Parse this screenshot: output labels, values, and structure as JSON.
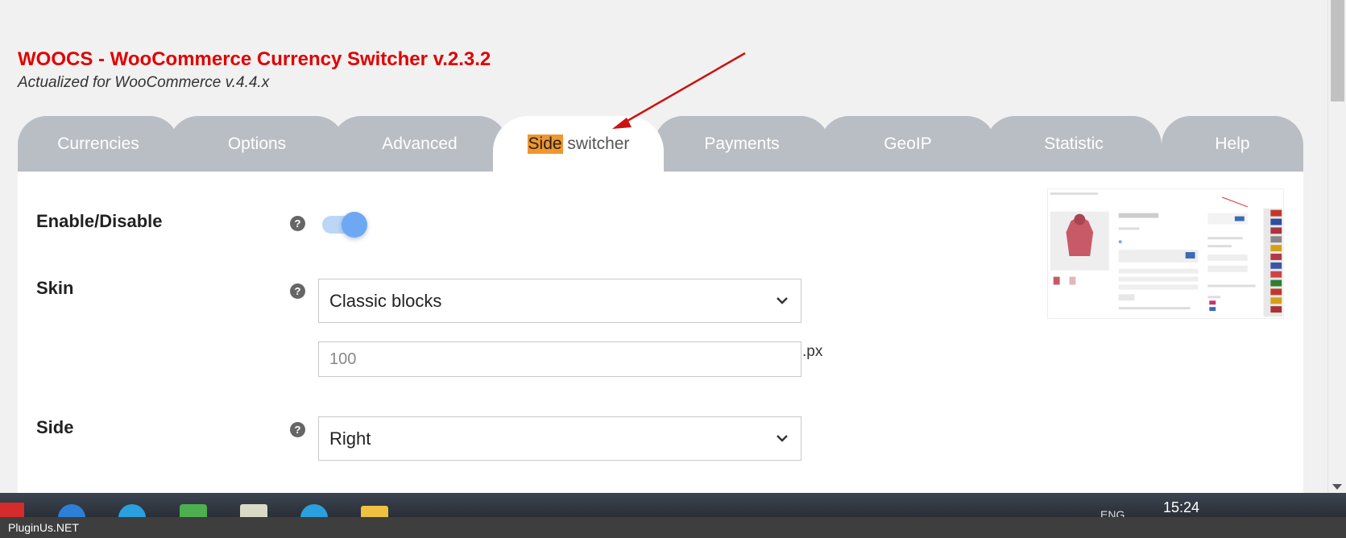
{
  "header": {
    "title": "WOOCS - WooCommerce Currency Switcher v.2.3.2",
    "subtitle": "Actualized for WooCommerce v.4.4.x"
  },
  "tabs": [
    {
      "label": "Currencies"
    },
    {
      "label": "Options"
    },
    {
      "label": "Advanced"
    },
    {
      "label_highlight": "Side",
      "label_rest": " switcher",
      "active": true
    },
    {
      "label": "Payments"
    },
    {
      "label": "GeoIP"
    },
    {
      "label": "Statistic"
    },
    {
      "label": "Help"
    }
  ],
  "settings": {
    "enable_label": "Enable/Disable",
    "enable_value": true,
    "skin_label": "Skin",
    "skin_value": "Classic blocks",
    "width_value": "100",
    "width_unit": ".px",
    "side_label": "Side",
    "side_value": "Right",
    "help_glyph": "?"
  },
  "taskbar": {
    "clock": "15:24",
    "language": "ENG"
  },
  "footer": {
    "text": "PluginUs.NET"
  },
  "colors": {
    "title": "#e10000",
    "tab_inactive": "#b9bec4",
    "tab_highlight": "#f0962e",
    "toggle_on": "#6ea8f3",
    "arrow": "#cc1111"
  },
  "icons": [
    "question-icon",
    "chevron-down-icon",
    "annotation-arrow-icon",
    "scroll-down-icon"
  ]
}
